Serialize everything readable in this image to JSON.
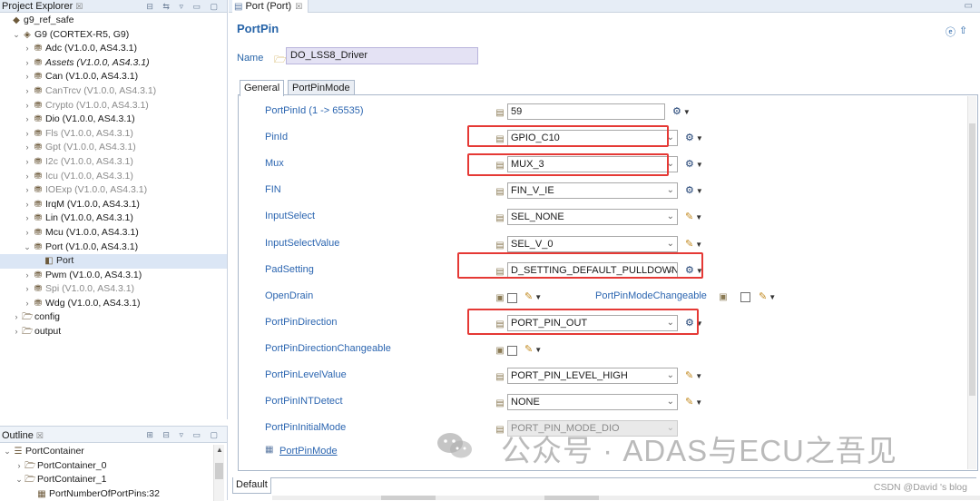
{
  "project_explorer": {
    "title": "Project Explorer",
    "close": "☒",
    "tools": "⊟ ⇆ ▿ ▭ ▢",
    "tree": [
      {
        "label": "g9_ref_safe",
        "level": 0,
        "twisty": "",
        "icon": "project-icon",
        "style": "normal"
      },
      {
        "label": "G9 (CORTEX-R5, G9)",
        "level": 1,
        "twisty": "v",
        "icon": "chip-icon",
        "style": "normal"
      },
      {
        "label": "Adc (V1.0.0, AS4.3.1)",
        "level": 2,
        "twisty": ">",
        "icon": "module-icon",
        "style": "normal"
      },
      {
        "label": "Assets (V1.0.0, AS4.3.1)",
        "level": 2,
        "twisty": ">",
        "icon": "module-icon",
        "style": "italic"
      },
      {
        "label": "Can (V1.0.0, AS4.3.1)",
        "level": 2,
        "twisty": ">",
        "icon": "module-icon",
        "style": "normal"
      },
      {
        "label": "CanTrcv (V1.0.0, AS4.3.1)",
        "level": 2,
        "twisty": ">",
        "icon": "module-icon",
        "style": "muted"
      },
      {
        "label": "Crypto (V1.0.0, AS4.3.1)",
        "level": 2,
        "twisty": ">",
        "icon": "module-icon",
        "style": "muted"
      },
      {
        "label": "Dio (V1.0.0, AS4.3.1)",
        "level": 2,
        "twisty": ">",
        "icon": "module-icon",
        "style": "normal"
      },
      {
        "label": "Fls (V1.0.0, AS4.3.1)",
        "level": 2,
        "twisty": ">",
        "icon": "module-icon",
        "style": "muted"
      },
      {
        "label": "Gpt (V1.0.0, AS4.3.1)",
        "level": 2,
        "twisty": ">",
        "icon": "module-icon",
        "style": "muted"
      },
      {
        "label": "I2c (V1.0.0, AS4.3.1)",
        "level": 2,
        "twisty": ">",
        "icon": "module-icon",
        "style": "muted"
      },
      {
        "label": "Icu (V1.0.0, AS4.3.1)",
        "level": 2,
        "twisty": ">",
        "icon": "module-icon",
        "style": "muted"
      },
      {
        "label": "IOExp (V1.0.0, AS4.3.1)",
        "level": 2,
        "twisty": ">",
        "icon": "module-icon",
        "style": "muted"
      },
      {
        "label": "IrqM (V1.0.0, AS4.3.1)",
        "level": 2,
        "twisty": ">",
        "icon": "module-icon",
        "style": "normal"
      },
      {
        "label": "Lin (V1.0.0, AS4.3.1)",
        "level": 2,
        "twisty": ">",
        "icon": "module-icon",
        "style": "normal"
      },
      {
        "label": "Mcu (V1.0.0, AS4.3.1)",
        "level": 2,
        "twisty": ">",
        "icon": "module-icon",
        "style": "normal"
      },
      {
        "label": "Port (V1.0.0, AS4.3.1)",
        "level": 2,
        "twisty": "v",
        "icon": "module-icon",
        "style": "normal"
      },
      {
        "label": "Port",
        "level": 3,
        "twisty": "",
        "icon": "container-icon",
        "style": "selected"
      },
      {
        "label": "Pwm (V1.0.0, AS4.3.1)",
        "level": 2,
        "twisty": ">",
        "icon": "module-icon",
        "style": "normal"
      },
      {
        "label": "Spi (V1.0.0, AS4.3.1)",
        "level": 2,
        "twisty": ">",
        "icon": "module-icon",
        "style": "muted"
      },
      {
        "label": "Wdg (V1.0.0, AS4.3.1)",
        "level": 2,
        "twisty": ">",
        "icon": "module-icon",
        "style": "normal"
      },
      {
        "label": "config",
        "level": 1,
        "twisty": ">",
        "icon": "folder-icon",
        "style": "normal"
      },
      {
        "label": "output",
        "level": 1,
        "twisty": ">",
        "icon": "folder-icon",
        "style": "normal"
      }
    ]
  },
  "outline": {
    "title": "Outline",
    "close": "☒",
    "tools": "⊞ ⊟ ▿ ▭ ▢",
    "tree": [
      {
        "label": "PortContainer",
        "level": 0,
        "twisty": "v",
        "icon": "list-icon"
      },
      {
        "label": "PortContainer_0",
        "level": 1,
        "twisty": ">",
        "icon": "folder-icon"
      },
      {
        "label": "PortContainer_1",
        "level": 1,
        "twisty": "v",
        "icon": "folder-icon"
      },
      {
        "label": "PortNumberOfPortPins:32",
        "level": 2,
        "twisty": "",
        "icon": "param-icon"
      }
    ]
  },
  "editor": {
    "tab_title": "Port (Port)",
    "tab_close": "☒",
    "minimize": "▭",
    "form_title": "PortPin",
    "name_label": "Name",
    "name_value": "DO_LSS8_Driver",
    "tabs": [
      "General",
      "PortPinMode"
    ],
    "params": [
      {
        "label": "PortPinId (1 -> 65535)",
        "kind": "text",
        "value": "59",
        "action": "calc"
      },
      {
        "label": "PinId",
        "kind": "combo",
        "value": "GPIO_C10",
        "action": "calc"
      },
      {
        "label": "Mux",
        "kind": "combo",
        "value": "MUX_3",
        "action": "calc"
      },
      {
        "label": "FIN",
        "kind": "combo",
        "value": "FIN_V_IE",
        "action": "calc"
      },
      {
        "label": "InputSelect",
        "kind": "combo",
        "value": "SEL_NONE",
        "action": "edit"
      },
      {
        "label": "InputSelectValue",
        "kind": "combo",
        "value": "SEL_V_0",
        "action": "edit"
      },
      {
        "label": "PadSetting",
        "kind": "combo",
        "value": "D_SETTING_DEFAULT_PULLDOWN",
        "action": "calc"
      },
      {
        "label": "OpenDrain",
        "kind": "check",
        "value": "",
        "action": "edit"
      },
      {
        "label": "PortPinDirection",
        "kind": "combo",
        "value": "PORT_PIN_OUT",
        "action": "calc"
      },
      {
        "label": "PortPinDirectionChangeable",
        "kind": "check",
        "value": "",
        "action": "edit"
      },
      {
        "label": "PortPinLevelValue",
        "kind": "combo",
        "value": "PORT_PIN_LEVEL_HIGH",
        "action": "edit"
      },
      {
        "label": "PortPinINTDetect",
        "kind": "combo",
        "value": "NONE",
        "action": "edit"
      },
      {
        "label": "PortPinInitialMode",
        "kind": "combo-disabled",
        "value": "PORT_PIN_MODE_DIO",
        "action": "none"
      }
    ],
    "extra_param_label": "PortPinModeChangeable",
    "link_label": "PortPinMode",
    "bottom_tab": "Default"
  },
  "watermark": {
    "text": "公众号 · ADAS与ECU之吾见",
    "credit": "CSDN @David 's blog"
  },
  "colors": {
    "accent": "#2764a8",
    "label_blue": "#2b65b0",
    "highlight_red": "#e53935",
    "name_field_bg": "#e4e2f4"
  }
}
